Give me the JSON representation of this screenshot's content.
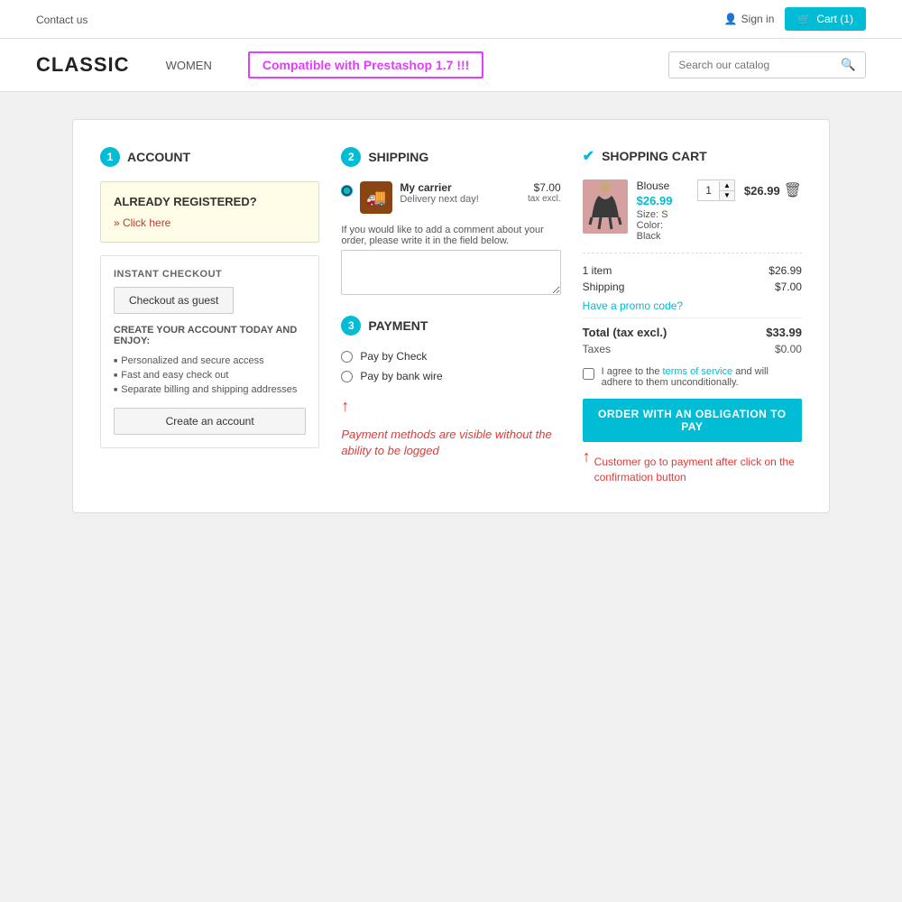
{
  "topbar": {
    "contact_label": "Contact us",
    "signin_label": "Sign in",
    "cart_label": "Cart (1)"
  },
  "header": {
    "logo": "CLASSIC",
    "nav_women": "WOMEN",
    "promo_badge": "Compatible with Prestashop 1.7 !!!",
    "search_placeholder": "Search our catalog"
  },
  "steps": {
    "account": {
      "number": "1",
      "label": "ACCOUNT",
      "already_registered_title": "ALREADY REGISTERED?",
      "click_here_link": "» Click here",
      "instant_checkout_title": "INSTANT CHECKOUT",
      "checkout_guest_btn": "Checkout as guest",
      "create_prompt": "CREATE YOUR ACCOUNT TODAY AND ENJOY:",
      "benefits": [
        "Personalized and secure access",
        "Fast and easy check out",
        "Separate billing and shipping addresses"
      ],
      "create_account_btn": "Create an account"
    },
    "shipping": {
      "number": "2",
      "label": "SHIPPING",
      "carrier_name": "My carrier",
      "carrier_delivery": "next day!",
      "carrier_delivery_label": "Delivery",
      "carrier_price": "$7.00",
      "carrier_tax": "tax excl.",
      "comment_label": "If you would like to add a comment about your order, please write it in the field below.",
      "comment_placeholder": ""
    },
    "payment": {
      "number": "3",
      "label": "PAYMENT",
      "options": [
        "Pay by Check",
        "Pay by bank wire"
      ],
      "payment_note": "Payment methods are visible without the ability to be logged",
      "arrow_label": "↑"
    }
  },
  "cart": {
    "label": "SHOPPING CART",
    "check_icon": "✔",
    "item": {
      "name": "Blouse",
      "price": "$26.99",
      "size_label": "Size:",
      "size_value": "S",
      "color_label": "Color:",
      "color_value": "Black",
      "qty": "1",
      "subtotal": "$26.99"
    },
    "summary": {
      "items_label": "1 item",
      "items_price": "$26.99",
      "shipping_label": "Shipping",
      "shipping_price": "$7.00",
      "promo_label": "Have a promo code?",
      "total_label": "Total (tax excl.)",
      "total_price": "$33.99",
      "taxes_label": "Taxes",
      "taxes_price": "$0.00"
    },
    "terms_text1": "I agree to the ",
    "terms_link": "terms of service",
    "terms_text2": " and will adhere to them unconditionally.",
    "order_btn": "ORDER WITH AN OBLIGATION TO PAY",
    "confirmation_note": "Customer go to payment after click on the confirmation button"
  }
}
